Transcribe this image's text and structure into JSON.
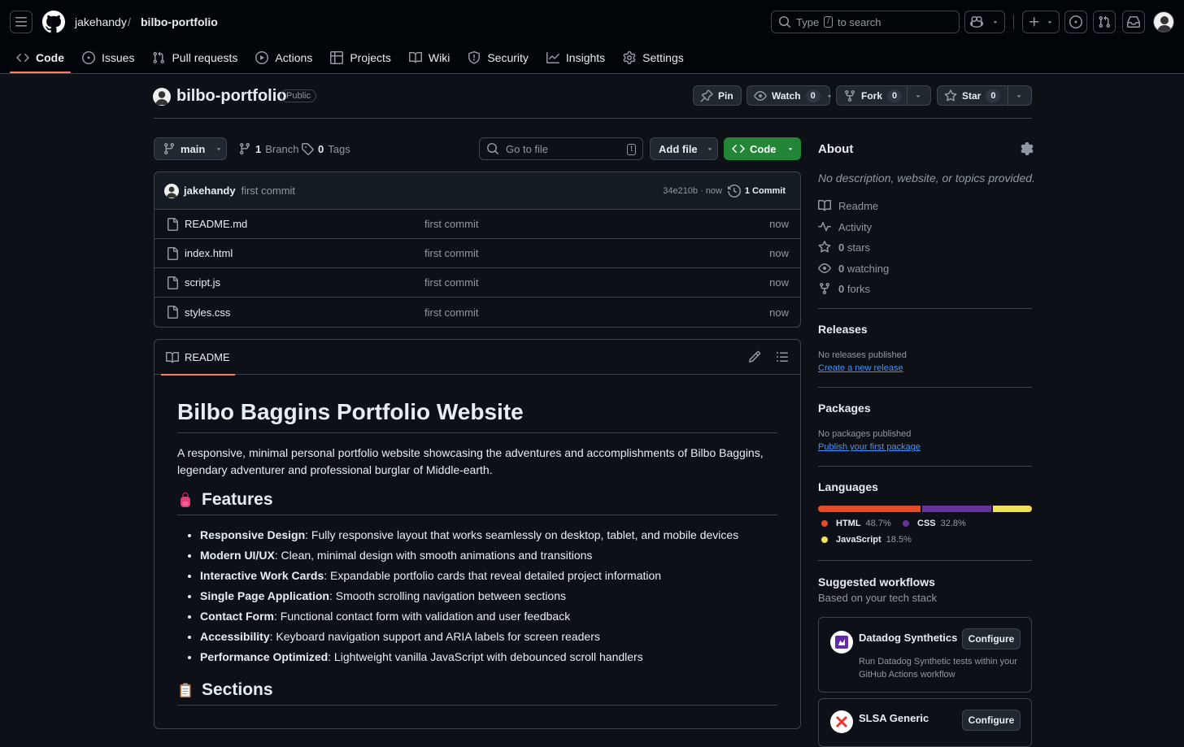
{
  "header": {
    "owner": "jakehandy",
    "separator": "/",
    "repo": "bilbo-portfolio",
    "search": {
      "prefix": "Type",
      "key": "/",
      "suffix": "to search"
    }
  },
  "tabs": [
    {
      "label": "Code",
      "icon": "code-icon",
      "active": true
    },
    {
      "label": "Issues",
      "icon": "issue-icon"
    },
    {
      "label": "Pull requests",
      "icon": "pull-request-icon"
    },
    {
      "label": "Actions",
      "icon": "play-icon"
    },
    {
      "label": "Projects",
      "icon": "table-icon"
    },
    {
      "label": "Wiki",
      "icon": "book-icon"
    },
    {
      "label": "Security",
      "icon": "shield-icon"
    },
    {
      "label": "Insights",
      "icon": "graph-icon"
    },
    {
      "label": "Settings",
      "icon": "gear-icon"
    }
  ],
  "repo": {
    "name": "bilbo-portfolio",
    "visibility": "Public",
    "pin_label": "Pin",
    "watch_label": "Watch",
    "watch_count": "0",
    "fork_label": "Fork",
    "fork_count": "0",
    "star_label": "Star",
    "star_count": "0"
  },
  "filenav": {
    "branch": "main",
    "branch_count": "1",
    "branch_label": "Branch",
    "tag_count": "0",
    "tag_label": "Tags",
    "goto_placeholder": "Go to file",
    "goto_key": "t",
    "add_file": "Add file",
    "code": "Code"
  },
  "commit": {
    "author": "jakehandy",
    "message": "first commit",
    "hash_time": "34e210b · now",
    "commits_label": "1 Commit"
  },
  "files": [
    {
      "name": "README.md",
      "message": "first commit",
      "time": "now"
    },
    {
      "name": "index.html",
      "message": "first commit",
      "time": "now"
    },
    {
      "name": "script.js",
      "message": "first commit",
      "time": "now"
    },
    {
      "name": "styles.css",
      "message": "first commit",
      "time": "now"
    }
  ],
  "readme": {
    "tab_label": "README",
    "title": "Bilbo Baggins Portfolio Website",
    "intro": "A responsive, minimal personal portfolio website showcasing the adventures and accomplishments of Bilbo Baggins, legendary adventurer and professional burglar of Middle-earth.",
    "features_heading": "Features",
    "features": [
      {
        "bold": "Responsive Design",
        "text": ": Fully responsive layout that works seamlessly on desktop, tablet, and mobile devices"
      },
      {
        "bold": "Modern UI/UX",
        "text": ": Clean, minimal design with smooth animations and transitions"
      },
      {
        "bold": "Interactive Work Cards",
        "text": ": Expandable portfolio cards that reveal detailed project information"
      },
      {
        "bold": "Single Page Application",
        "text": ": Smooth scrolling navigation between sections"
      },
      {
        "bold": "Contact Form",
        "text": ": Functional contact form with validation and user feedback"
      },
      {
        "bold": "Accessibility",
        "text": ": Keyboard navigation support and ARIA labels for screen readers"
      },
      {
        "bold": "Performance Optimized",
        "text": ": Lightweight vanilla JavaScript with debounced scroll handlers"
      }
    ],
    "sections_heading": "Sections"
  },
  "about": {
    "heading": "About",
    "description": "No description, website, or topics provided.",
    "readme": "Readme",
    "activity": "Activity",
    "stars_count": "0",
    "stars_label": "stars",
    "watching_count": "0",
    "watching_label": "watching",
    "forks_count": "0",
    "forks_label": "forks"
  },
  "releases": {
    "heading": "Releases",
    "empty": "No releases published",
    "link": "Create a new release"
  },
  "packages": {
    "heading": "Packages",
    "empty": "No packages published",
    "link": "Publish your first package"
  },
  "languages": {
    "heading": "Languages",
    "items": [
      {
        "name": "HTML",
        "percent": "48.7%",
        "value": 48.7,
        "color": "#e34c26"
      },
      {
        "name": "CSS",
        "percent": "32.8%",
        "value": 32.8,
        "color": "#663399"
      },
      {
        "name": "JavaScript",
        "percent": "18.5%",
        "value": 18.5,
        "color": "#f1e05a"
      }
    ]
  },
  "workflows": {
    "heading": "Suggested workflows",
    "subheading": "Based on your tech stack",
    "items": [
      {
        "name": "Datadog Synthetics",
        "button": "Configure",
        "description": "Run Datadog Synthetic tests within your GitHub Actions workflow"
      },
      {
        "name": "SLSA Generic",
        "button": "Configure",
        "description": ""
      }
    ]
  },
  "colors": {
    "background": "#0d1117",
    "header": "#010409",
    "border": "#3d444d",
    "accent_tab": "#f78166",
    "primary_button": "#238636",
    "link": "#4493f8"
  }
}
